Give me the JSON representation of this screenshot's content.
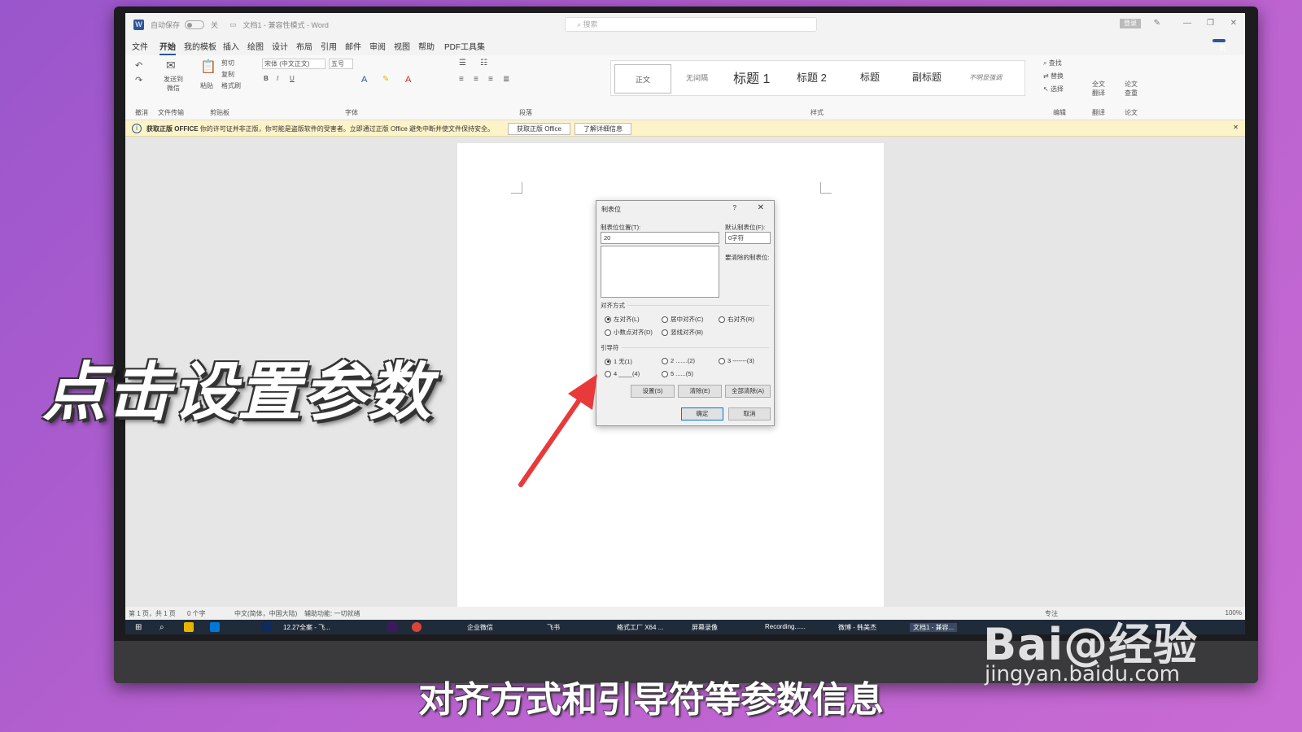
{
  "titlebar": {
    "app_icon": "W",
    "autosave": "自动保存",
    "toggle_state": "关",
    "doc_title": "文档1 - 兼容性模式 - Word",
    "search_placeholder": "搜索",
    "login": "登录"
  },
  "menu": {
    "items": [
      "文件",
      "开始",
      "我的模板",
      "插入",
      "绘图",
      "设计",
      "布局",
      "引用",
      "邮件",
      "审阅",
      "视图",
      "帮助",
      "PDF工具集"
    ],
    "active": "开始",
    "share": "共享"
  },
  "ribbon": {
    "undo_label": "撤消",
    "send_label": "发送到微信",
    "file_transfer": "文件传输",
    "paste": "粘贴",
    "cut": "剪切",
    "copy": "复制",
    "format_painter": "格式刷",
    "clipboard": "剪贴板",
    "font_name": "宋体 (中文正文)",
    "font_size": "五号",
    "font_group": "字体",
    "paragraph_group": "段落",
    "styles": [
      "无间隔",
      "标题 1",
      "标题 2",
      "标题",
      "副标题",
      "不明显强调"
    ],
    "style_selected": "正文",
    "styles_group": "样式",
    "find": "查找",
    "replace": "替换",
    "select": "选择",
    "edit_group": "编辑",
    "translate": "全文翻译",
    "translate_group": "翻译",
    "paper_check": "论文查重",
    "paper_group": "论文"
  },
  "infobar": {
    "icon": "i",
    "bold": "获取正版 OFFICE",
    "message": "你的许可证并非正版，你可能是盗版软件的受害者。立即通过正版 Office 避免中断并使文件保持安全。",
    "btn1": "获取正版 Office",
    "btn2": "了解详细信息"
  },
  "dialog": {
    "title": "制表位",
    "help": "?",
    "close": "✕",
    "tab_pos_label": "制表位位置(T):",
    "tab_pos_value": "20",
    "default_label": "默认制表位(F):",
    "default_value": "0字符",
    "clear_label": "要清除的制表位:",
    "align_label": "对齐方式",
    "align_options": [
      "左对齐(L)",
      "居中对齐(C)",
      "右对齐(R)",
      "小数点对齐(D)",
      "竖线对齐(B)"
    ],
    "leader_label": "引导符",
    "leader_options": [
      "1 无(1)",
      "2 .......(2)",
      "3 -------(3)",
      "4 ____(4)",
      "5 ......(5)"
    ],
    "btn_set": "设置(S)",
    "btn_clear": "清除(E)",
    "btn_clear_all": "全部清除(A)",
    "btn_ok": "确定",
    "btn_cancel": "取消"
  },
  "statusbar": {
    "page": "第 1 页，共 1 页",
    "words": "0 个字",
    "lang": "中文(简体，中国大陆)",
    "accessibility": "辅助功能: 一切就绪",
    "focus": "专注",
    "zoom": "100%"
  },
  "taskbar": {
    "items": [
      "12.27全案 - 飞...",
      "企业微信",
      "飞书",
      "格式工厂 X64 ...",
      "屏幕录像",
      "Recording......",
      "微博 - 韩美杰",
      "文档1 - 兼容..."
    ]
  },
  "overlay": {
    "caption": "点击设置参数",
    "subtitle": "对齐方式和引导符等参数信息"
  },
  "watermark": {
    "logo": "Bai@经验",
    "url": "jingyan.baidu.com"
  },
  "colors": {
    "word_blue": "#2b579a",
    "arrow_red": "#e83a3a",
    "infobar_yellow": "#fdf3c8"
  }
}
